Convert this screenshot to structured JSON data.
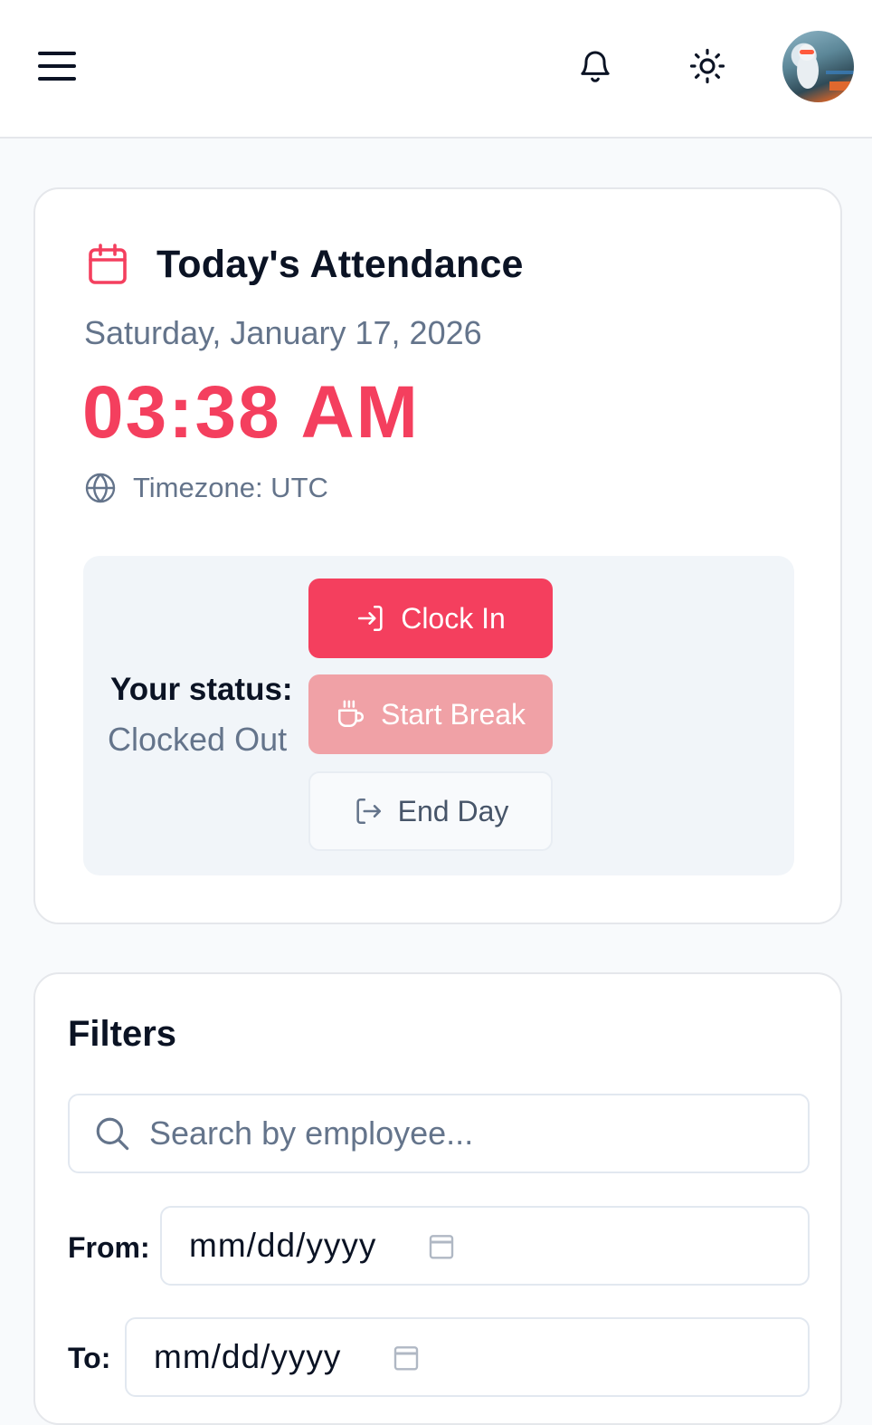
{
  "header": {
    "menu_icon": "menu-icon",
    "notification_icon": "bell-icon",
    "theme_icon": "sun-icon",
    "avatar_icon": "user-avatar"
  },
  "attendance": {
    "title": "Today's Attendance",
    "date": "Saturday, January 17, 2026",
    "time": "03:38 AM",
    "timezone": "Timezone: UTC",
    "status_label": "Your status:",
    "status_value": "Clocked Out",
    "buttons": {
      "clock_in": "Clock In",
      "start_break": "Start Break",
      "end_day": "End Day"
    }
  },
  "filters": {
    "title": "Filters",
    "search_placeholder": "Search by employee...",
    "from_label": "From:",
    "to_label": "To:",
    "from_value": "mm/dd/yyyy",
    "to_value": "mm/dd/yyyy"
  },
  "colors": {
    "accent": "#f43f5e",
    "accent_disabled": "#f0a1a6",
    "muted_text": "#64748b"
  }
}
